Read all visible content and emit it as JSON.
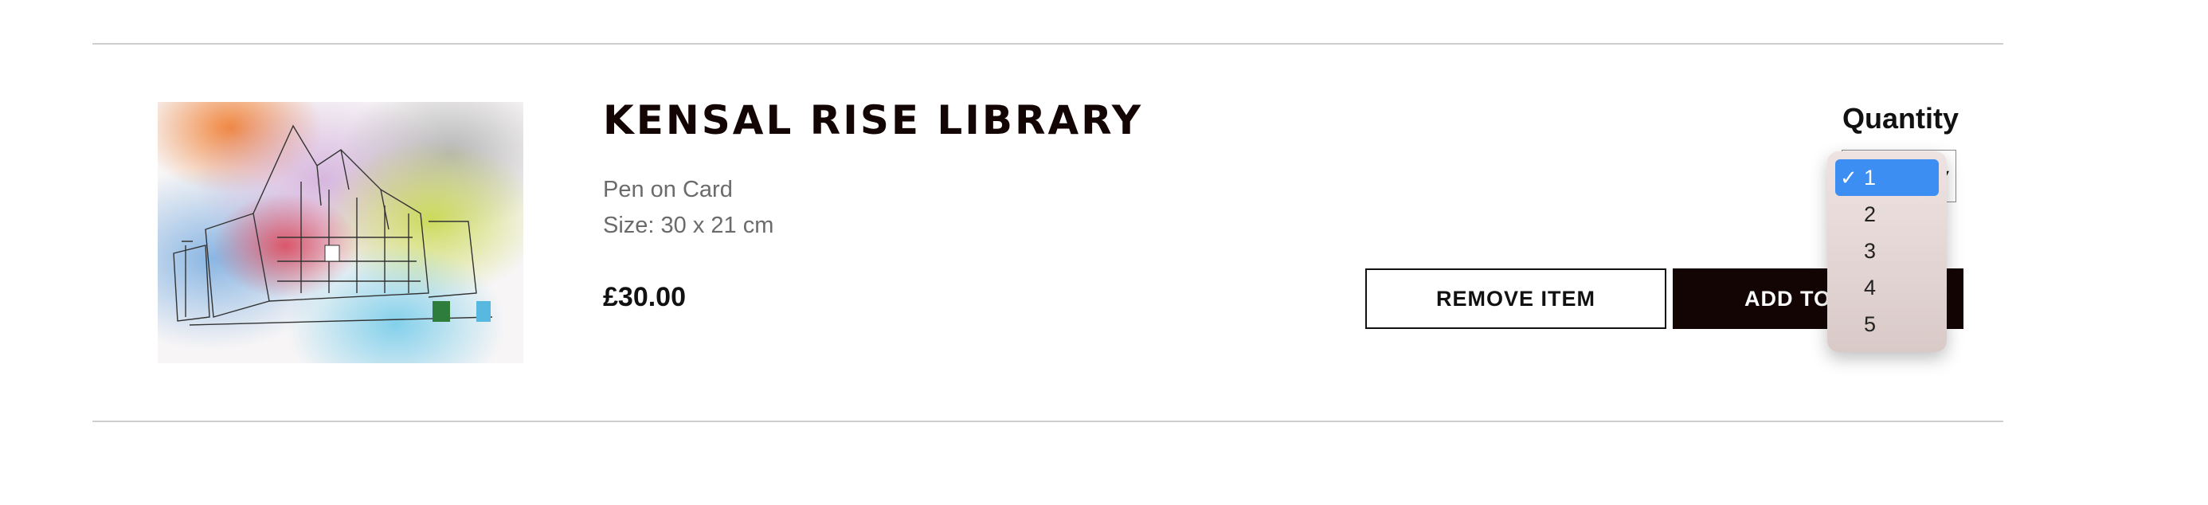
{
  "item": {
    "title": "KENSAL RISE LIBRARY",
    "medium": "Pen on Card",
    "size": "Size: 30 x 21 cm",
    "price": "£30.00"
  },
  "actions": {
    "remove_label": "REMOVE ITEM",
    "add_label": "ADD TO"
  },
  "quantity": {
    "label": "Quantity",
    "selected": "1",
    "options": [
      "1",
      "2",
      "3",
      "4",
      "5"
    ],
    "check_glyph": "✓"
  },
  "colors": {
    "accent": "#3d8ef3",
    "primary_button": "#140505",
    "divider": "#cfcfcf"
  }
}
